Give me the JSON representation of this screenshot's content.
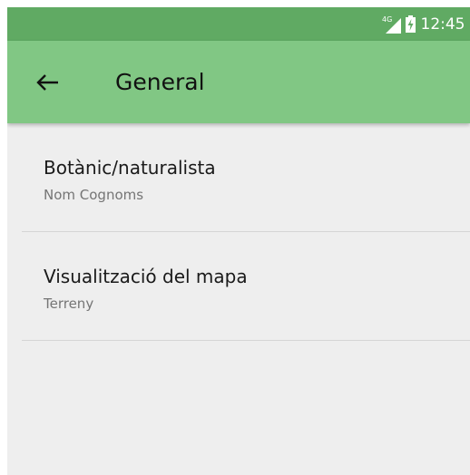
{
  "status_bar": {
    "network_label": "4G",
    "network_icon": "signal-4g-icon",
    "battery_icon": "battery-charging-icon",
    "time": "12:45",
    "color": "#60aa63"
  },
  "app_bar": {
    "back_icon": "arrow-left-icon",
    "title": "General",
    "color": "#81c784"
  },
  "preferences": [
    {
      "title": "Botànic/naturalista",
      "summary": "Nom Cognoms"
    },
    {
      "title": "Visualització del mapa",
      "summary": "Terreny"
    }
  ],
  "colors": {
    "background": "#eeeeee",
    "divider": "#d5d5d5",
    "summary_text": "#757575"
  }
}
